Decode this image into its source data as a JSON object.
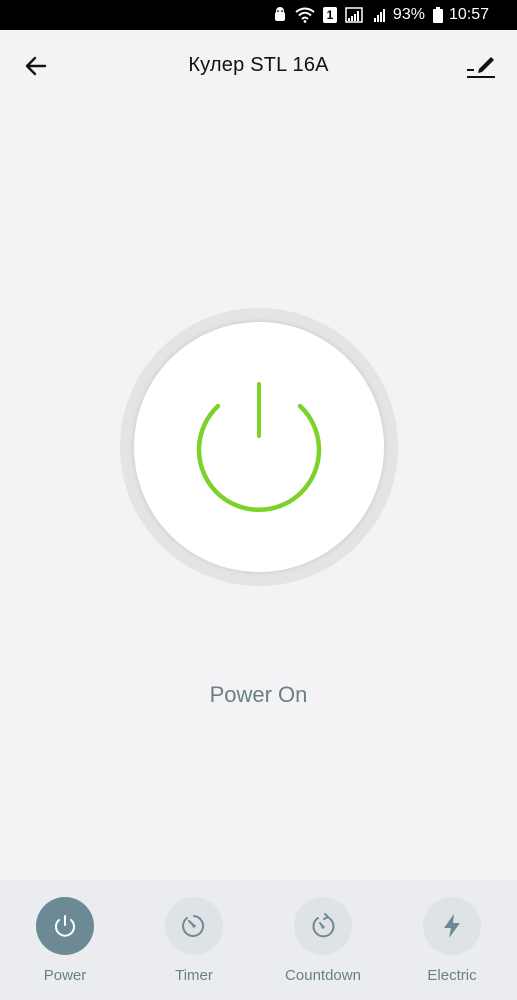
{
  "status_bar": {
    "battery_percent": "93%",
    "time": "10:57",
    "sim_badge": "1",
    "icons": [
      "android-icon",
      "wifi-icon",
      "signal-icon",
      "battery-icon"
    ]
  },
  "header": {
    "title": "Кулер STL 16A",
    "back_icon": "arrow-left-icon",
    "edit_icon": "pencil-icon"
  },
  "device": {
    "state": "on",
    "status_text": "Power On",
    "accent_color": "#7cd12a"
  },
  "bottom_tabs": [
    {
      "label": "Power",
      "icon": "power-icon",
      "active": true
    },
    {
      "label": "Timer",
      "icon": "timer-icon",
      "active": false
    },
    {
      "label": "Countdown",
      "icon": "countdown-icon",
      "active": false
    },
    {
      "label": "Electric",
      "icon": "lightning-icon",
      "active": false
    }
  ]
}
